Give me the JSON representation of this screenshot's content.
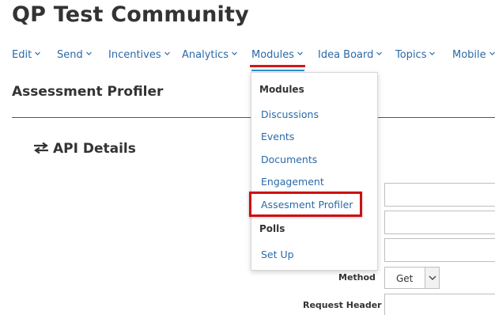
{
  "app": {
    "title": "QP Test Community"
  },
  "nav": {
    "items": [
      {
        "label": "Edit"
      },
      {
        "label": "Send"
      },
      {
        "label": "Incentives"
      },
      {
        "label": "Analytics"
      },
      {
        "label": "Modules"
      },
      {
        "label": "Idea Board"
      },
      {
        "label": "Topics"
      },
      {
        "label": "Mobile"
      }
    ],
    "active_index": 4
  },
  "page": {
    "title": "Assessment Profiler"
  },
  "section": {
    "title": "API Details",
    "icon": "exchange-arrows-icon"
  },
  "form": {
    "method_label": "Method",
    "method_value": "Get",
    "request_header_label": "Request Header"
  },
  "dropdown": {
    "group1_header": "Modules",
    "items": [
      {
        "label": "Discussions"
      },
      {
        "label": "Events"
      },
      {
        "label": "Documents"
      },
      {
        "label": "Engagement"
      },
      {
        "label": "Assesment Profiler"
      }
    ],
    "group2_header": "Polls",
    "group2_items": [
      {
        "label": "Set Up"
      }
    ],
    "highlighted_index": 4
  },
  "colors": {
    "link": "#2a6aa8",
    "highlight_border": "#cc1111",
    "active_underline_red": "#d01818",
    "active_underline_blue": "#2a8fd0",
    "text": "#333333"
  }
}
